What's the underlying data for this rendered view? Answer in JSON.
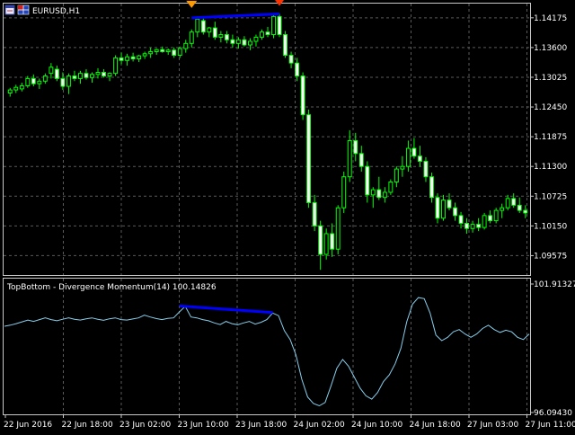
{
  "chart_data": [
    {
      "type": "candlestick",
      "title": "EURUSD,H1",
      "ylim": [
        1.092,
        1.1445
      ],
      "yticks": [
        "1.14175",
        "1.13600",
        "1.13025",
        "1.12450",
        "1.11875",
        "1.11300",
        "1.10725",
        "1.10150",
        "1.09575"
      ],
      "candles": [
        [
          1.1272,
          1.1282,
          1.1265,
          1.1278
        ],
        [
          1.1278,
          1.1288,
          1.1272,
          1.1283
        ],
        [
          1.128,
          1.1292,
          1.1275,
          1.1286
        ],
        [
          1.1286,
          1.1305,
          1.1282,
          1.13
        ],
        [
          1.13,
          1.1308,
          1.1285,
          1.129
        ],
        [
          1.129,
          1.13,
          1.128,
          1.1295
        ],
        [
          1.1295,
          1.131,
          1.129,
          1.1305
        ],
        [
          1.131,
          1.133,
          1.13,
          1.1322
        ],
        [
          1.1318,
          1.1325,
          1.1295,
          1.13
        ],
        [
          1.13,
          1.1312,
          1.1278,
          1.1285
        ],
        [
          1.1285,
          1.131,
          1.127,
          1.1305
        ],
        [
          1.1305,
          1.1315,
          1.1295,
          1.13
        ],
        [
          1.13,
          1.1315,
          1.129,
          1.131
        ],
        [
          1.131,
          1.1318,
          1.1298,
          1.1302
        ],
        [
          1.1302,
          1.1312,
          1.1292,
          1.1308
        ],
        [
          1.1308,
          1.132,
          1.13,
          1.1312
        ],
        [
          1.1312,
          1.1318,
          1.1302,
          1.1305
        ],
        [
          1.1305,
          1.1312,
          1.1295,
          1.131
        ],
        [
          1.131,
          1.1345,
          1.1305,
          1.134
        ],
        [
          1.134,
          1.135,
          1.1328,
          1.1335
        ],
        [
          1.1335,
          1.1348,
          1.1325,
          1.1342
        ],
        [
          1.1342,
          1.135,
          1.1333,
          1.1338
        ],
        [
          1.1338,
          1.1346,
          1.1332,
          1.1344
        ],
        [
          1.1344,
          1.1352,
          1.1338,
          1.1348
        ],
        [
          1.1348,
          1.136,
          1.134,
          1.1352
        ],
        [
          1.1352,
          1.1358,
          1.1346,
          1.1356
        ],
        [
          1.1356,
          1.1362,
          1.135,
          1.1352
        ],
        [
          1.1352,
          1.1358,
          1.1346,
          1.1355
        ],
        [
          1.1355,
          1.136,
          1.134,
          1.1345
        ],
        [
          1.1345,
          1.1362,
          1.134,
          1.1358
        ],
        [
          1.1358,
          1.1375,
          1.135,
          1.1368
        ],
        [
          1.1368,
          1.1395,
          1.136,
          1.139
        ],
        [
          1.139,
          1.142,
          1.138,
          1.1415
        ],
        [
          1.1412,
          1.142,
          1.1385,
          1.139
        ],
        [
          1.139,
          1.14,
          1.138,
          1.1398
        ],
        [
          1.1398,
          1.141,
          1.1375,
          1.138
        ],
        [
          1.138,
          1.1392,
          1.137,
          1.1385
        ],
        [
          1.1385,
          1.1392,
          1.1368,
          1.1375
        ],
        [
          1.1375,
          1.1385,
          1.136,
          1.1368
        ],
        [
          1.1368,
          1.138,
          1.1358,
          1.1375
        ],
        [
          1.1375,
          1.1382,
          1.1362,
          1.1365
        ],
        [
          1.1365,
          1.1378,
          1.1355,
          1.1372
        ],
        [
          1.1372,
          1.1385,
          1.1362,
          1.138
        ],
        [
          1.138,
          1.1395,
          1.1375,
          1.139
        ],
        [
          1.139,
          1.14,
          1.138,
          1.1385
        ],
        [
          1.1385,
          1.1425,
          1.1378,
          1.142
        ],
        [
          1.142,
          1.1425,
          1.138,
          1.1385
        ],
        [
          1.1385,
          1.1392,
          1.134,
          1.1345
        ],
        [
          1.1345,
          1.1352,
          1.132,
          1.133
        ],
        [
          1.133,
          1.134,
          1.1295,
          1.1305
        ],
        [
          1.1305,
          1.1312,
          1.122,
          1.123
        ],
        [
          1.123,
          1.124,
          1.105,
          1.106
        ],
        [
          1.106,
          1.1075,
          1.1005,
          1.1015
        ],
        [
          1.1015,
          1.1025,
          1.093,
          1.096
        ],
        [
          1.096,
          1.101,
          1.095,
          1.1
        ],
        [
          1.1,
          1.102,
          1.0955,
          1.097
        ],
        [
          1.097,
          1.1055,
          1.096,
          1.105
        ],
        [
          1.105,
          1.112,
          1.104,
          1.111
        ],
        [
          1.111,
          1.12,
          1.11,
          1.118
        ],
        [
          1.118,
          1.1195,
          1.114,
          1.1155
        ],
        [
          1.1155,
          1.117,
          1.112,
          1.113
        ],
        [
          1.113,
          1.114,
          1.106,
          1.1075
        ],
        [
          1.1075,
          1.109,
          1.105,
          1.1085
        ],
        [
          1.1085,
          1.111,
          1.1065,
          1.107
        ],
        [
          1.107,
          1.109,
          1.106,
          1.108
        ],
        [
          1.108,
          1.1105,
          1.1075,
          1.11
        ],
        [
          1.11,
          1.113,
          1.109,
          1.1125
        ],
        [
          1.1125,
          1.115,
          1.111,
          1.113
        ],
        [
          1.113,
          1.118,
          1.112,
          1.1165
        ],
        [
          1.1165,
          1.1185,
          1.1145,
          1.115
        ],
        [
          1.115,
          1.117,
          1.113,
          1.114
        ],
        [
          1.114,
          1.1148,
          1.11,
          1.111
        ],
        [
          1.111,
          1.1118,
          1.106,
          1.107
        ],
        [
          1.107,
          1.1078,
          1.102,
          1.103
        ],
        [
          1.103,
          1.1075,
          1.1025,
          1.1065
        ],
        [
          1.1065,
          1.1078,
          1.1045,
          1.105
        ],
        [
          1.105,
          1.106,
          1.1025,
          1.1035
        ],
        [
          1.1035,
          1.1042,
          1.101,
          1.102
        ],
        [
          1.102,
          1.103,
          1.1,
          1.101
        ],
        [
          1.101,
          1.1025,
          1.1002,
          1.1018
        ],
        [
          1.1018,
          1.103,
          1.1005,
          1.1012
        ],
        [
          1.1012,
          1.104,
          1.1008,
          1.1035
        ],
        [
          1.1035,
          1.1045,
          1.102,
          1.1025
        ],
        [
          1.1025,
          1.105,
          1.102,
          1.1045
        ],
        [
          1.1045,
          1.1058,
          1.103,
          1.105
        ],
        [
          1.105,
          1.1075,
          1.1045,
          1.1068
        ],
        [
          1.1068,
          1.1078,
          1.105,
          1.1055
        ],
        [
          1.1055,
          1.107,
          1.104,
          1.1045
        ],
        [
          1.1045,
          1.1055,
          1.103,
          1.104
        ]
      ],
      "annotations": [
        {
          "type": "trendline",
          "color": "#0000ff",
          "from": [
            31,
            1.14175
          ],
          "to": [
            46,
            1.1425
          ]
        },
        {
          "type": "arrow",
          "color": "#ff9900",
          "at": 31,
          "price": 1.144
        },
        {
          "type": "arrow",
          "color": "#ff3300",
          "at": 46,
          "price": 1.1444
        }
      ]
    },
    {
      "type": "line",
      "title": "TopBottom - Divergence Momentum(14) 100.14826",
      "ylim": [
        96.0943,
        101.91327
      ],
      "yticks": [
        "101.91327",
        "96.09430"
      ],
      "line_color": "#87ceeb",
      "values": [
        100.0,
        100.05,
        100.12,
        100.2,
        100.28,
        100.22,
        100.3,
        100.38,
        100.3,
        100.25,
        100.32,
        100.38,
        100.32,
        100.28,
        100.34,
        100.38,
        100.32,
        100.27,
        100.34,
        100.38,
        100.3,
        100.28,
        100.33,
        100.38,
        100.5,
        100.42,
        100.35,
        100.3,
        100.36,
        100.38,
        100.65,
        100.9,
        100.42,
        100.38,
        100.3,
        100.25,
        100.15,
        100.08,
        100.22,
        100.12,
        100.07,
        100.15,
        100.22,
        100.1,
        100.18,
        100.3,
        100.6,
        100.48,
        99.8,
        99.4,
        98.7,
        97.6,
        96.8,
        96.5,
        96.4,
        96.55,
        97.3,
        98.1,
        98.5,
        98.2,
        97.7,
        97.2,
        96.85,
        96.7,
        97.0,
        97.5,
        97.8,
        98.3,
        99.0,
        100.2,
        101.0,
        101.3,
        101.25,
        100.6,
        99.6,
        99.35,
        99.5,
        99.75,
        99.85,
        99.65,
        99.5,
        99.65,
        99.9,
        100.05,
        99.85,
        99.72,
        99.82,
        99.75,
        99.5,
        99.4,
        99.65
      ]
    }
  ],
  "xaxis_labels": [
    "22 Jun 2016",
    "22 Jun 18:00",
    "23 Jun 02:00",
    "23 Jun 10:00",
    "23 Jun 18:00",
    "24 Jun 02:00",
    "24 Jun 10:00",
    "24 Jun 18:00",
    "27 Jun 03:00",
    "27 Jun 11:00"
  ],
  "colors": {
    "background": "#000000",
    "grid": "#5a5a5a",
    "frame": "#c8c8c8",
    "text": "#ffffff",
    "candle_up_fill": "#000000",
    "candle_down_fill": "#ffffff",
    "candle_outline": "#00ff00"
  },
  "icons": [
    "chart-window-icon",
    "flag-icon"
  ]
}
